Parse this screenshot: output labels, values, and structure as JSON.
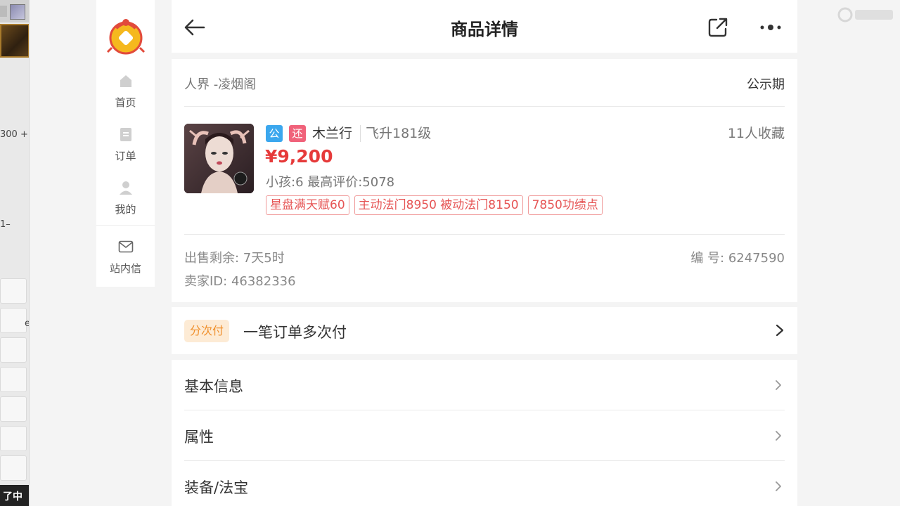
{
  "background_window": {
    "text_1": "300 +",
    "text_2": "1–",
    "text_3": "e",
    "bottom_text": "了中"
  },
  "sidebar": {
    "items": [
      {
        "label": "首页",
        "icon": "home-icon"
      },
      {
        "label": "订单",
        "icon": "order-icon"
      },
      {
        "label": "我的",
        "icon": "user-icon"
      },
      {
        "label": "站内信",
        "icon": "mail-icon"
      }
    ]
  },
  "header": {
    "title": "商品详情"
  },
  "item": {
    "server": "人界 -凌烟阁",
    "status": "公示期",
    "badge_public": "公",
    "badge_bargain": "还",
    "name": "木兰行",
    "level": "飞升181级",
    "favorites": "11人收藏",
    "price": "¥9,200",
    "meta": "小孩:6 最高评价:5078",
    "tags": [
      "星盘满天赋60",
      "主动法门8950 被动法门8150",
      "7850功绩点"
    ],
    "sale_remaining": "出售剩余: 7天5时",
    "serial": "编 号: 6247590",
    "seller_id": "卖家ID: 46382336"
  },
  "installment": {
    "badge": "分次付",
    "text": "一笔订单多次付"
  },
  "detail_sections": [
    {
      "label": "基本信息"
    },
    {
      "label": "属性"
    },
    {
      "label": "装备/法宝"
    }
  ],
  "colors": {
    "price": "#e63a3a",
    "tag_border": "#f09a9a",
    "badge_public": "#3ba7ee",
    "badge_bargain": "#f0627a",
    "installment_bg": "#fdebd5",
    "installment_text": "#f0902c"
  }
}
